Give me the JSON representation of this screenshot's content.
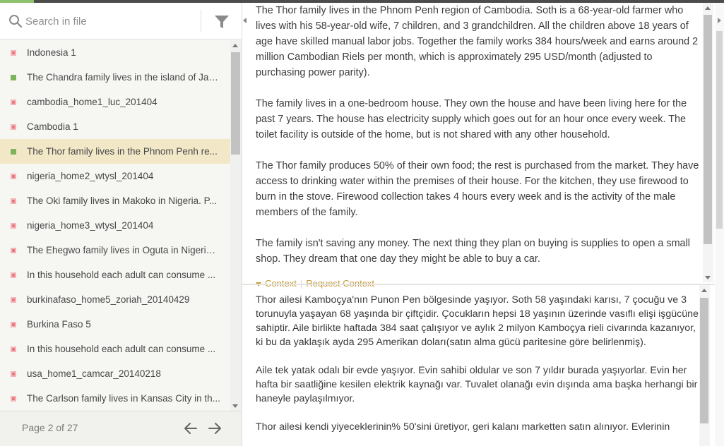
{
  "colors": {
    "accent": "#8dc26f",
    "selected_bg": "#f2e8c8",
    "status_red": "#e97a80",
    "status_green": "#7cb35b",
    "context_link": "#c49a3a"
  },
  "search": {
    "placeholder": "Search in file",
    "icon": "search-icon",
    "filter_icon": "filter-icon"
  },
  "segments": [
    {
      "label": "Indonesia 1",
      "status": "red"
    },
    {
      "label": "The Chandra family lives in the island of Java...",
      "status": "green"
    },
    {
      "label": "cambodia_home1_luc_201404",
      "status": "red"
    },
    {
      "label": "Cambodia 1",
      "status": "red"
    },
    {
      "label": "The Thor family lives in the Phnom Penh re...",
      "status": "green",
      "selected": true
    },
    {
      "label": "nigeria_home2_wtysl_201404",
      "status": "red"
    },
    {
      "label": "The Oki family lives in Makoko in Nigeria. P...",
      "status": "red"
    },
    {
      "label": "nigeria_home3_wtysl_201404",
      "status": "red"
    },
    {
      "label": "The Ehegwo family lives in Oguta in Nigeria....",
      "status": "red"
    },
    {
      "label": "In this household each adult can consume ...",
      "status": "red"
    },
    {
      "label": "burkinafaso_home5_zoriah_20140429",
      "status": "red"
    },
    {
      "label": "Burkina Faso 5",
      "status": "red"
    },
    {
      "label": "In this household each adult can consume ...",
      "status": "red"
    },
    {
      "label": "usa_home1_camcar_20140218",
      "status": "red"
    },
    {
      "label": "The Carlson family lives in Kansas City in th...",
      "status": "red"
    }
  ],
  "pager": {
    "text": "Page 2 of 27",
    "prev_icon": "arrow-left-icon",
    "next_icon": "arrow-right-icon"
  },
  "source": {
    "paragraphs": [
      "The Thor family lives in the Phnom Penh region of Cambodia. Soth is a 68-year-old farmer who lives with his 58-year-old wife, 7 children, and 3 grandchildren. All the children above 18 years of age have skilled manual labor jobs. Together the family works 384 hours/week and earns around 2 million Cambodian Riels per month, which is approximately 295 USD/month (adjusted to purchasing power parity).",
      "The family lives in a one-bedroom house. They own the house and have been living here for the past 7 years. The house has electricity supply which goes out for an hour once every week. The toilet facility is outside of the home, but is not shared with any other household.",
      "The Thor family produces 50% of their own food; the rest is purchased from the market. They have access to drinking water within the premises of their house. For the kitchen, they use firewood to burn in the stove. Firewood collection takes 4 hours every week and is the activity of the male members of the family.",
      "The family isn't saving any money. The next thing they plan on buying is supplies to open a small shop. They dream that one day they might be able to buy a car."
    ]
  },
  "context": {
    "toggle_label": "Context",
    "request_label": "Request Context"
  },
  "target": {
    "paragraphs": [
      "Thor ailesi Kamboçya'nın Punon Pen bölgesinde yaşıyor. Soth 58 yaşındaki karısı, 7 çocuğu ve 3 torunuyla yaşayan 68 yaşında bir çiftçidir. Çocukların hepsi 18 yaşının üzerinde vasıflı elişi işgücüne sahiptir. Aile birlikte haftada 384 saat çalışıyor ve aylık 2 milyon Kamboçya rieli civarında kazanıyor, ki bu da yaklaşık ayda 295 Amerikan doları(satın alma gücü paritesine göre belirlenmiş).",
      "Aile tek yatak odalı bir evde yaşıyor. Evin sahibi oldular ve son 7 yıldır burada yaşıyorlar. Evin her hafta bir saatliğine kesilen elektrik kaynağı var. Tuvalet olanağı evin dışında ama başka herhangi bir haneyle paylaşılmıyor.",
      "Thor ailesi kendi yiyeceklerinin% 50'sini üretiyor, geri kalanı marketten satın alınıyor. Evlerinin"
    ]
  }
}
